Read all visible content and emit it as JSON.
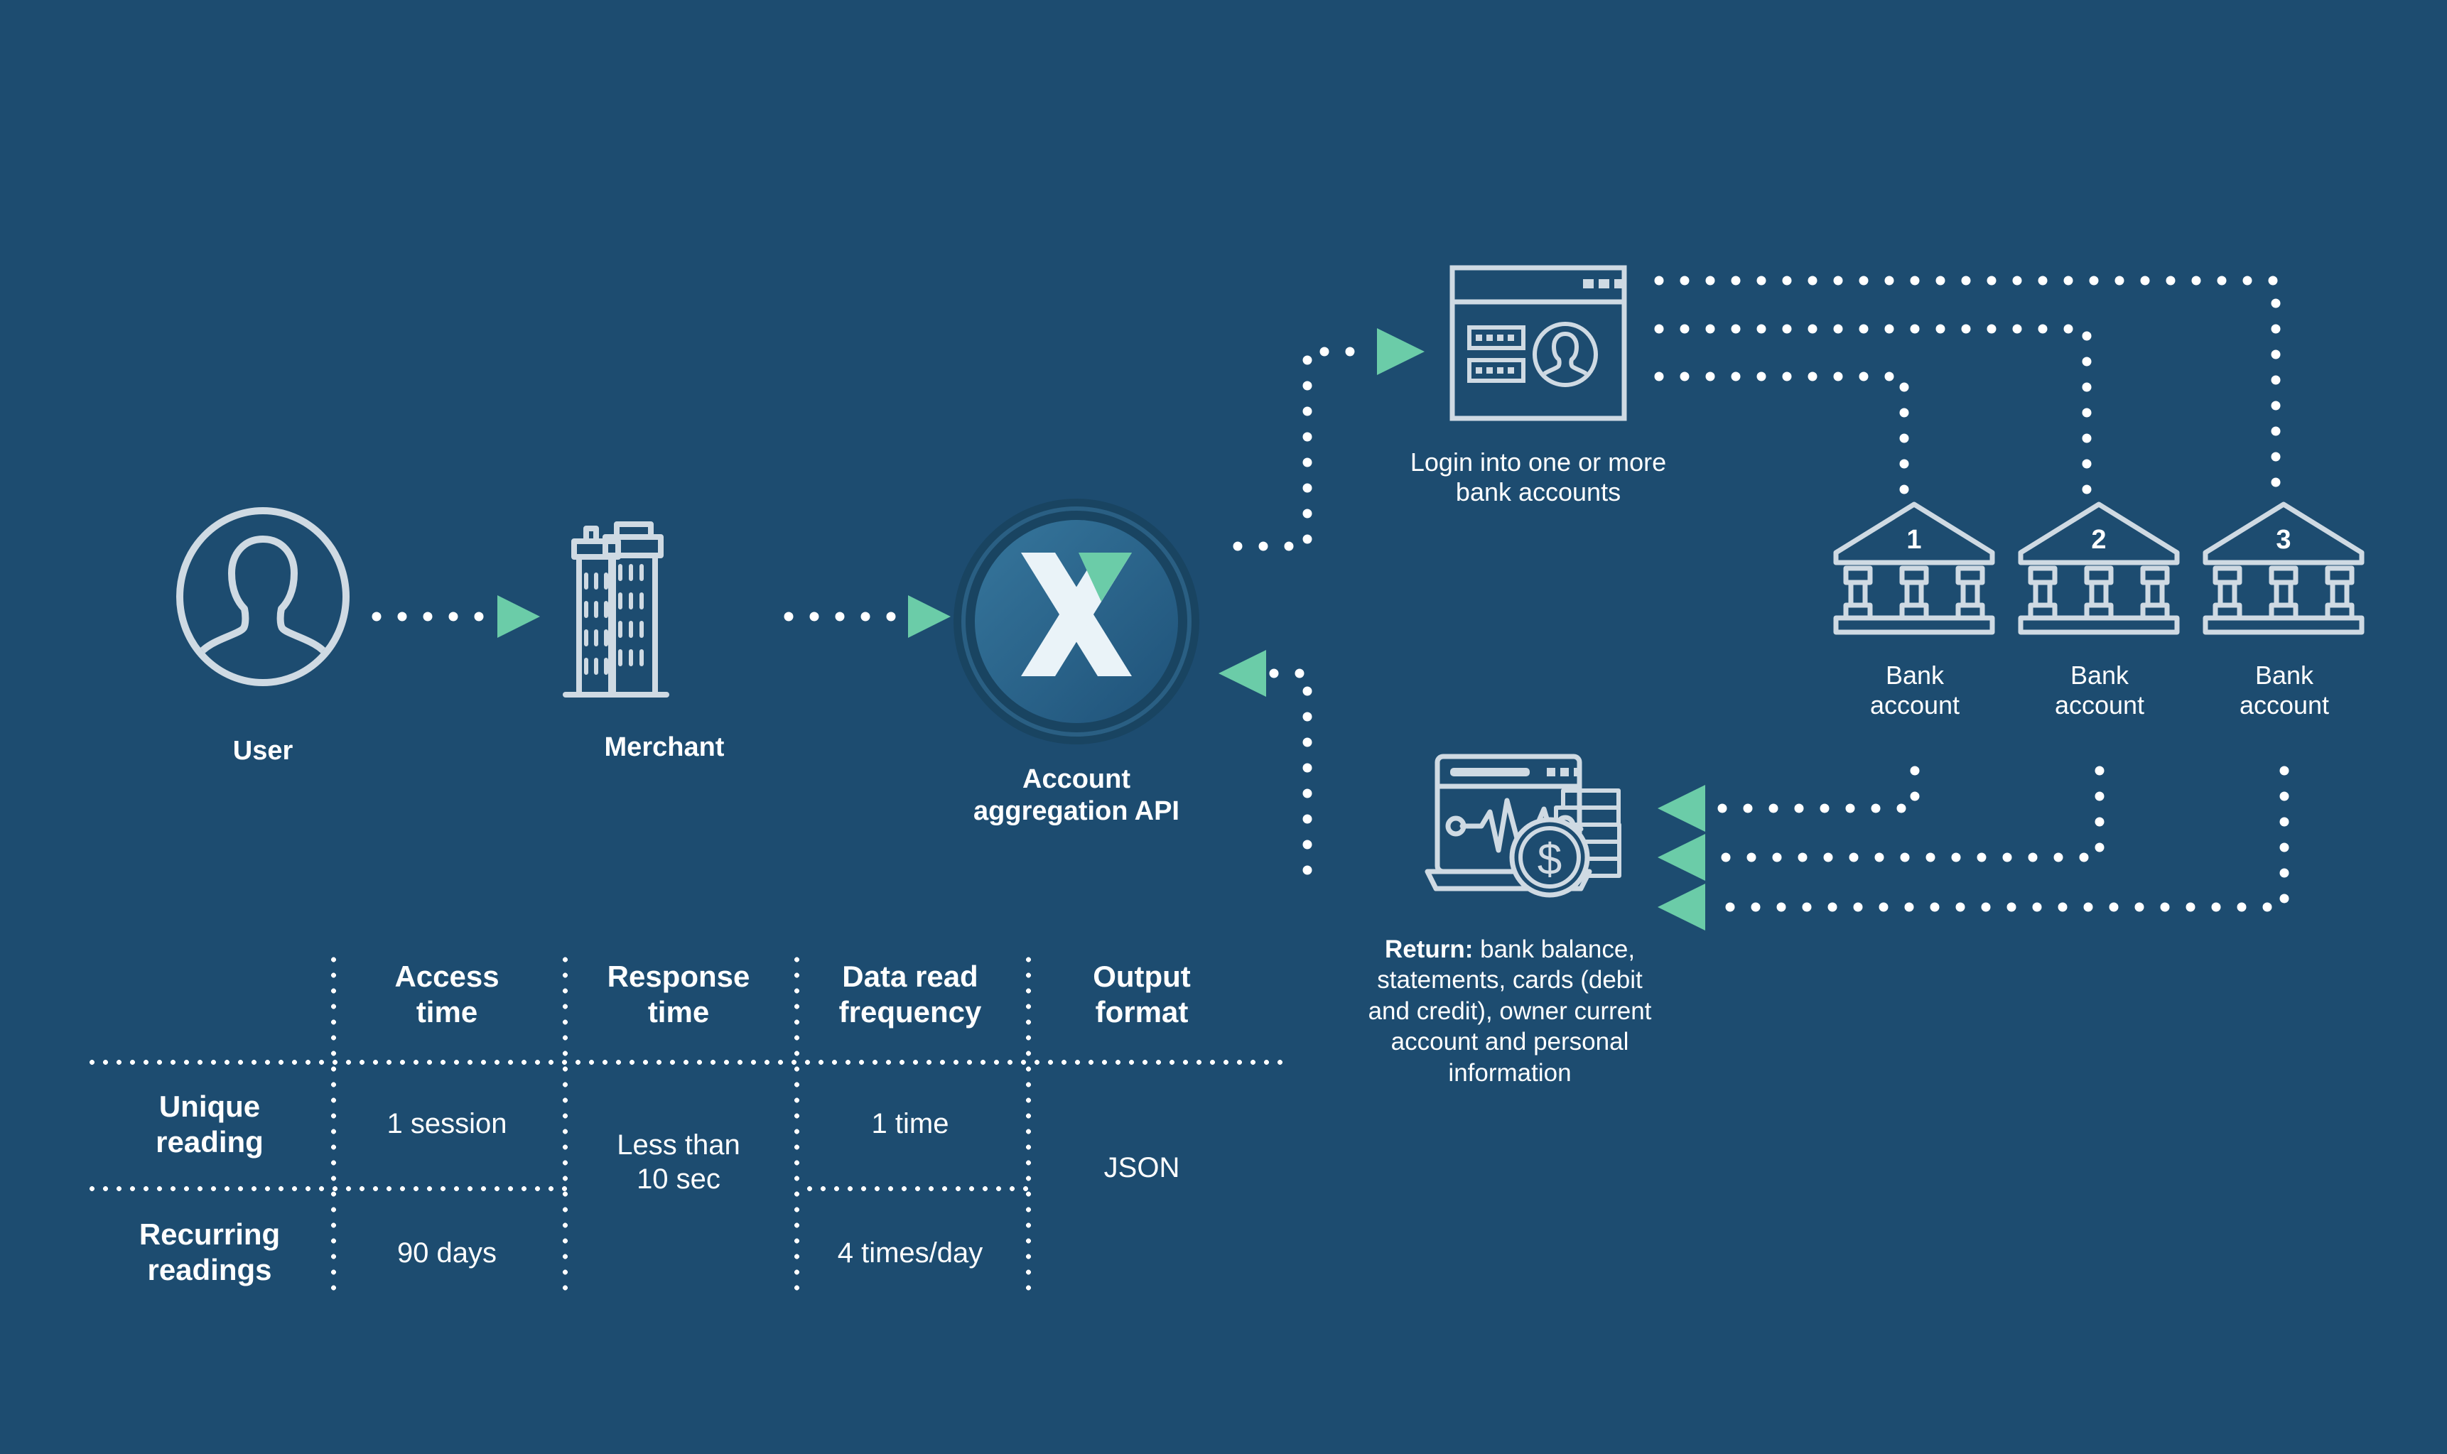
{
  "theme": {
    "background": "#1d4c70",
    "accent_green": "#6bcca8",
    "icon_stroke": "#cfdae3",
    "text": "#ffffff",
    "api_circle_outer": "#194461",
    "api_circle_inner_from": "#2f6d93",
    "api_circle_inner_to": "#23587c"
  },
  "flow": {
    "user": {
      "label": "User",
      "icon": "user-avatar-icon"
    },
    "merchant": {
      "label": "Merchant",
      "icon": "office-building-icon"
    },
    "api": {
      "label_line1": "Account",
      "label_line2": "aggregation API",
      "icon": "x-logo-icon"
    },
    "login": {
      "label_line1": "Login into one or more",
      "label_line2": "bank accounts",
      "icon": "browser-login-window-icon"
    },
    "banks": [
      {
        "number": "1",
        "label_line1": "Bank",
        "label_line2": "account",
        "icon": "bank-building-icon"
      },
      {
        "number": "2",
        "label_line1": "Bank",
        "label_line2": "account",
        "icon": "bank-building-icon"
      },
      {
        "number": "3",
        "label_line1": "Bank",
        "label_line2": "account",
        "icon": "bank-building-icon"
      }
    ],
    "return": {
      "icon": "chart-coins-icon",
      "label_bold": "Return:",
      "label_rest": " bank balance, statements, cards (debit and credit), owner current account and personal information"
    }
  },
  "spec_table": {
    "columns": [
      "",
      "Access time",
      "Response time",
      "Data read frequency",
      "Output format"
    ],
    "rows": [
      {
        "label": "Unique reading",
        "access_time": "1 session",
        "response_time": "Less than 10 sec",
        "data_read_frequency": "1 time",
        "output_format": "JSON"
      },
      {
        "label": "Recurring readings",
        "access_time": "90 days",
        "response_time": "Less than 10 sec",
        "data_read_frequency": "4 times/day",
        "output_format": "JSON"
      }
    ],
    "headers": {
      "access_time_l1": "Access",
      "access_time_l2": "time",
      "response_time_l1": "Response",
      "response_time_l2": "time",
      "data_read_l1": "Data read",
      "data_read_l2": "frequency",
      "output_l1": "Output",
      "output_l2": "format"
    },
    "row_labels": {
      "r1l1": "Unique",
      "r1l2": "reading",
      "r2l1": "Recurring",
      "r2l2": "readings"
    },
    "values": {
      "r1_access": "1 session",
      "r2_access": "90 days",
      "response_l1": "Less than",
      "response_l2": "10 sec",
      "r1_freq": "1 time",
      "r2_freq": "4 times/day",
      "output": "JSON"
    }
  }
}
